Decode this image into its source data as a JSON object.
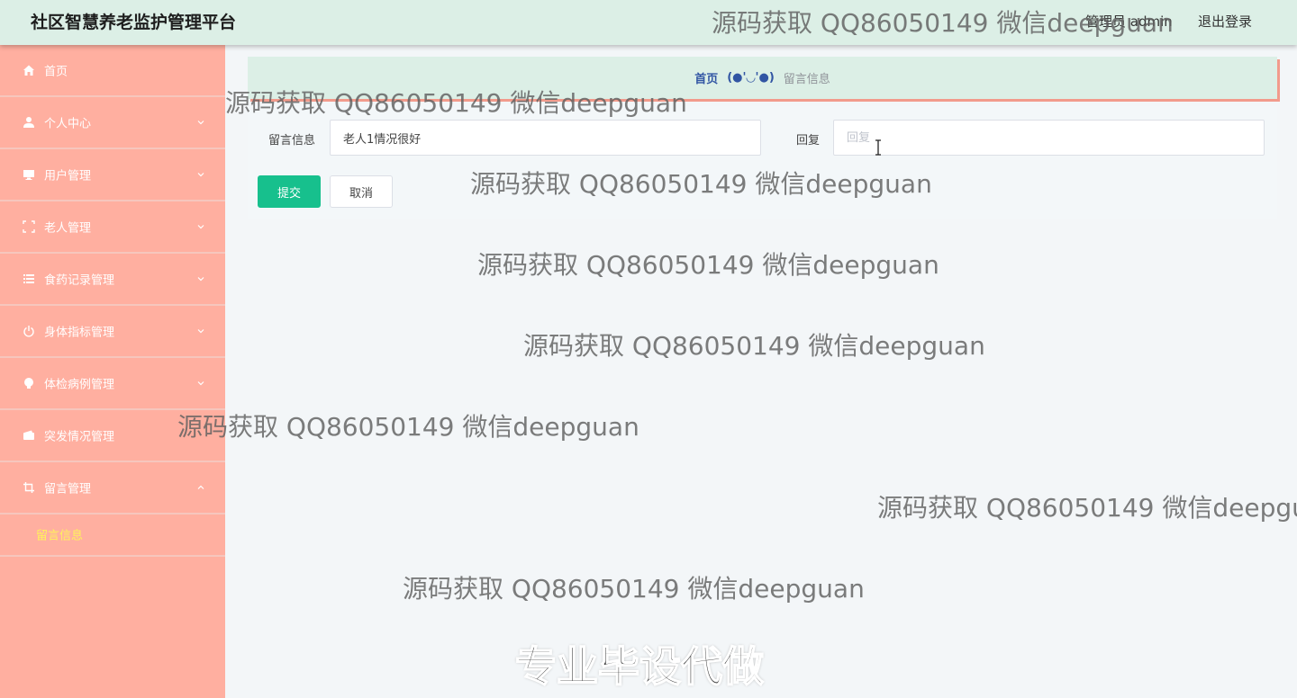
{
  "header": {
    "title": "社区智慧养老监护管理平台",
    "user_label": "管理员 admin",
    "logout_label": "退出登录"
  },
  "sidebar": {
    "items": [
      {
        "label": "首页",
        "icon": "home-icon"
      },
      {
        "label": "个人中心",
        "icon": "user-icon"
      },
      {
        "label": "用户管理",
        "icon": "monitor-icon"
      },
      {
        "label": "老人管理",
        "icon": "scan-icon"
      },
      {
        "label": "食药记录管理",
        "icon": "list-icon"
      },
      {
        "label": "身体指标管理",
        "icon": "power-icon"
      },
      {
        "label": "体检病例管理",
        "icon": "bulb-icon"
      },
      {
        "label": "突发情况管理",
        "icon": "wallet-icon"
      },
      {
        "label": "留言管理",
        "icon": "crop-icon"
      }
    ],
    "submenu": {
      "label": "留言信息"
    }
  },
  "breadcrumb": {
    "home": "首页",
    "separator": "(●'◡'●)",
    "current": "留言信息"
  },
  "form": {
    "message_label": "留言信息",
    "message_value": "老人1情况很好",
    "reply_label": "回复",
    "reply_placeholder": "回复",
    "submit_label": "提交",
    "cancel_label": "取消"
  },
  "watermarks": {
    "text": "源码获取 QQ86050149 微信deepguan",
    "promo": "专业毕设代做"
  },
  "colors": {
    "sidebar_bg": "#ffafa0",
    "header_bg": "#dcefe6",
    "submenu_active": "#fff35a",
    "submit_button": "#17c08d",
    "breadcrumb_home": "#3155a3"
  }
}
